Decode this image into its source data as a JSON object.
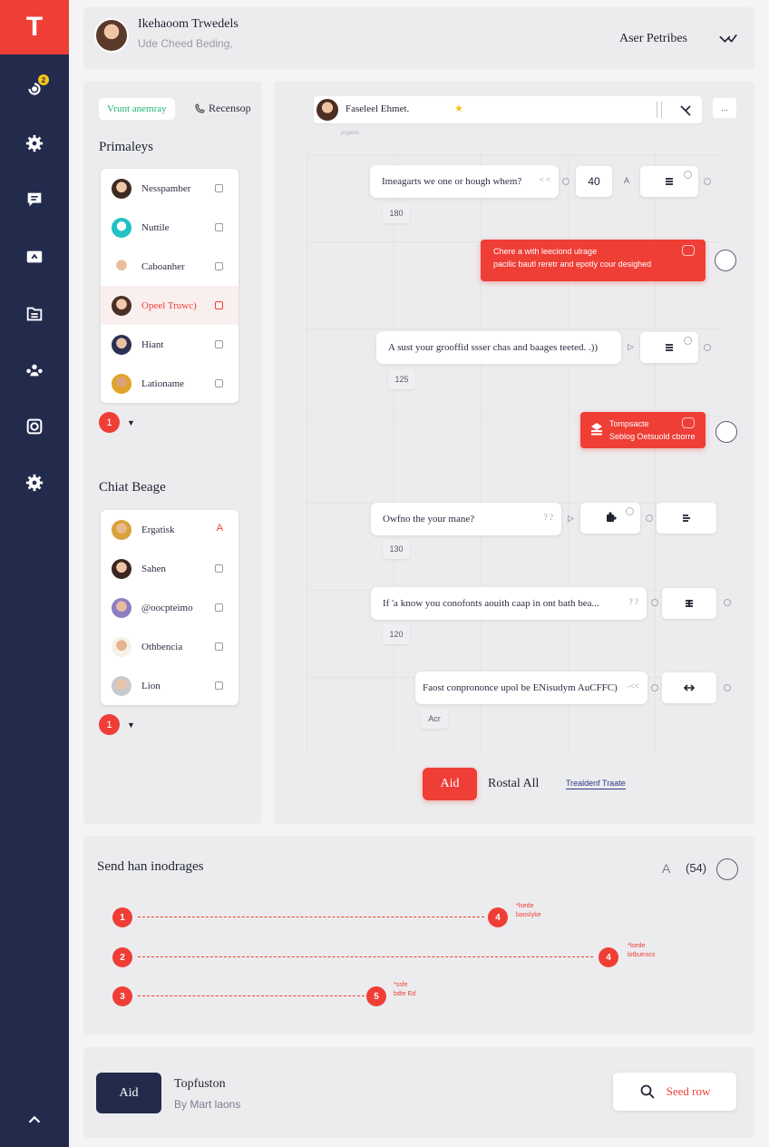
{
  "header": {
    "title": "Ikehaoom Trwedels",
    "subtitle": "Ude Cheed Beding,",
    "right_label": "Aser Petribes"
  },
  "sidebar": {
    "logo": "T",
    "badge": "2",
    "icons": [
      "bell-icon",
      "gear-icon",
      "chat-icon",
      "ticket-icon",
      "folder-icon",
      "team-icon",
      "camera-icon",
      "settings-icon",
      "chevron-up-icon"
    ]
  },
  "left": {
    "chip_label": "Vrunt anemray",
    "chip2_label": "Recensop",
    "section1_title": "Primaleys",
    "list1": [
      {
        "name": "Nesspamber"
      },
      {
        "name": "Nuttile"
      },
      {
        "name": "Caboanher"
      },
      {
        "name": "Opeel Truwc)",
        "active": true
      },
      {
        "name": "Hiant"
      },
      {
        "name": "Lationame"
      }
    ],
    "pager1": "1",
    "section2_title": "Chiat Beage",
    "list2": [
      {
        "name": "Ergatisk",
        "mark": "A"
      },
      {
        "name": "Sahen"
      },
      {
        "name": "@oocpteimo"
      },
      {
        "name": "Othbencia"
      },
      {
        "name": "Lion"
      }
    ],
    "pager2": "1"
  },
  "flow": {
    "top_title": "Faseleel Ehmet.",
    "top_sub": "prganlo",
    "top_mini": "...",
    "rows": [
      {
        "text": "Imeagarts we one or hough whem?",
        "end": "< <",
        "num": "180",
        "box_value": "40"
      },
      {
        "red1_line1": "Chere a with leeciond ulrage",
        "red1_line2": "pacilic bautl reretr and epotly cour desighed"
      },
      {
        "text": "A sust your grooffid ssser chas and baages teeted. .))",
        "num": "125"
      },
      {
        "red2_line1": "Tompsacte",
        "red2_line2": "Seblog Oetsuold cborre"
      },
      {
        "text": "Owfno the your mane?",
        "end": "? ?",
        "num": "130"
      },
      {
        "text": "If 'a know you conofonts aouith caap in ont bath bea...",
        "end": "? ?",
        "num": "120"
      },
      {
        "text": "Faost conprononce upol be ENisudym AuCFFC)",
        "end": "-<<",
        "num": "Acr"
      }
    ],
    "aid_label": "Aid",
    "postal_label": "Rostal All",
    "link_label": "Trealdenf Traate"
  },
  "send": {
    "title": "Send han inodrages",
    "count_prefix": "A",
    "count": "(54)",
    "tracks": [
      {
        "start": "1",
        "end": "4",
        "label1": "*lsede",
        "label2": "baoslyke"
      },
      {
        "start": "2",
        "end": "4",
        "label1": "*lsede",
        "label2": "lotbutrocs"
      },
      {
        "start": "3",
        "end": "5",
        "label1": "*ssfe",
        "label2": "bdte Ed"
      }
    ]
  },
  "footer": {
    "button": "Aid",
    "title": "Topfuston",
    "subtitle": "By Mart laons",
    "send_label": "Seed row"
  },
  "colors": {
    "accent": "#ee3e36",
    "sidebar": "#232b4d",
    "green": "#22b573"
  }
}
